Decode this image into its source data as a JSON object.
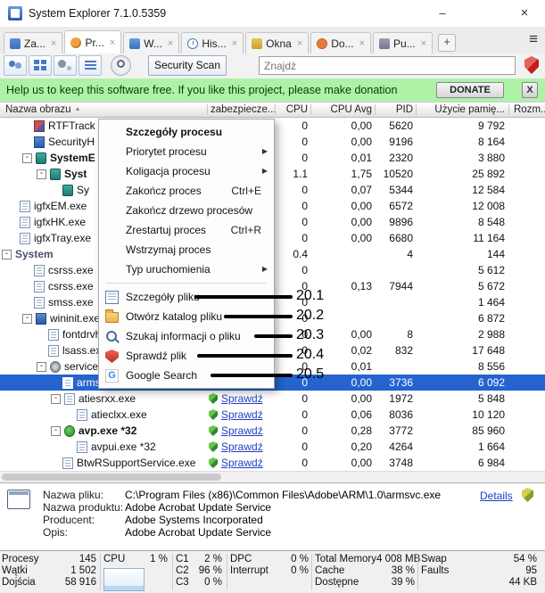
{
  "window": {
    "title": "System Explorer 7.1.0.5359",
    "minimize": "–",
    "close": "×"
  },
  "glyphs": {
    "collapse": "-",
    "sort": "▲",
    "submenu": "▶",
    "tab_close": "×",
    "google_letter": "G"
  },
  "colors": {
    "selection": "#2563cf",
    "donation_bg": "#aef2a8",
    "link": "#1f3fc0",
    "annotation": "#000000"
  },
  "tabs": {
    "items": [
      {
        "label": "Za...",
        "icon": "tasks"
      },
      {
        "label": "Pr...",
        "icon": "process",
        "active": true
      },
      {
        "label": "W...",
        "icon": "performance"
      },
      {
        "label": "His...",
        "icon": "history"
      },
      {
        "label": "Okna",
        "icon": "windows"
      },
      {
        "label": "Do...",
        "icon": "addons"
      },
      {
        "label": "Pu...",
        "icon": "autorun"
      }
    ],
    "add_label": "+",
    "menu_glyph": "≡"
  },
  "toolbar": {
    "security_scan_label": "Security Scan",
    "search_placeholder": "Znajdź"
  },
  "donation": {
    "message": "Help us to keep this software free.  If you like this project, please make donation",
    "donate_label": "DONATE",
    "close_label": "X"
  },
  "columns": {
    "name": "Nazwa obrazu",
    "security": "zabezpiecze...",
    "cpu": "CPU",
    "cpu_avg": "CPU Avg",
    "pid": "PID",
    "memory": "Użycie pamię...",
    "size": "Rozm..."
  },
  "processes": [
    {
      "name": "RTFTrack",
      "level": 2,
      "box": false,
      "icon": "app-red",
      "security": "",
      "cpu": "0",
      "cpu_avg": "0,00",
      "pid": "5620",
      "memory": "9 792"
    },
    {
      "name": "SecurityH",
      "level": 2,
      "box": false,
      "icon": "app-blue",
      "security": "",
      "cpu": "0",
      "cpu_avg": "0,00",
      "pid": "9196",
      "memory": "8 164"
    },
    {
      "name": "SystemE",
      "level": 2,
      "box": true,
      "icon": "app-teal",
      "bold": true,
      "security": "",
      "cpu": "0",
      "cpu_avg": "0,01",
      "pid": "2320",
      "memory": "3 880"
    },
    {
      "name": "Syst",
      "level": 3,
      "box": true,
      "icon": "app-teal",
      "bold": true,
      "security": "",
      "cpu": "1.1",
      "cpu_avg": "1,75",
      "pid": "10520",
      "memory": "25 892"
    },
    {
      "name": "Sy",
      "level": 4,
      "box": false,
      "icon": "app-teal",
      "security": "",
      "cpu": "0",
      "cpu_avg": "0,07",
      "pid": "5344",
      "memory": "12 584"
    },
    {
      "name": "igfxEM.exe",
      "level": 1,
      "box": false,
      "icon": "doc",
      "security": "",
      "cpu": "0",
      "cpu_avg": "0,00",
      "pid": "6572",
      "memory": "12 008"
    },
    {
      "name": "igfxHK.exe",
      "level": 1,
      "box": false,
      "icon": "doc",
      "security": "",
      "cpu": "0",
      "cpu_avg": "0,00",
      "pid": "9896",
      "memory": "8 548"
    },
    {
      "name": "igfxTray.exe",
      "level": 1,
      "box": false,
      "icon": "doc",
      "security": "",
      "cpu": "0",
      "cpu_avg": "0,00",
      "pid": "6680",
      "memory": "11 164"
    },
    {
      "name": "System",
      "level": 0,
      "box": true,
      "icon": "",
      "bold": true,
      "dim": true,
      "security": "",
      "cpu": "0.4",
      "cpu_avg": "",
      "pid": "4",
      "memory": "144"
    },
    {
      "name": "csrss.exe",
      "level": 2,
      "box": false,
      "icon": "doc",
      "security": "",
      "cpu": "0",
      "cpu_avg": "",
      "pid": "",
      "memory": "5 612"
    },
    {
      "name": "csrss.exe",
      "level": 2,
      "box": false,
      "icon": "doc",
      "security": "",
      "cpu": "0",
      "cpu_avg": "0,13",
      "pid": "7944",
      "memory": "5 672"
    },
    {
      "name": "smss.exe",
      "level": 2,
      "box": false,
      "icon": "doc",
      "security": "",
      "cpu": "0",
      "cpu_avg": "",
      "pid": "",
      "memory": "1 464"
    },
    {
      "name": "wininit.exe",
      "level": 2,
      "box": true,
      "icon": "app-blue",
      "security": "",
      "cpu": "0",
      "cpu_avg": "",
      "pid": "",
      "memory": "6 872"
    },
    {
      "name": "fontdrvhost.exe",
      "level": 3,
      "box": false,
      "icon": "doc",
      "security": "",
      "cpu": "0",
      "cpu_avg": "0,00",
      "pid": "8",
      "memory": "2 988"
    },
    {
      "name": "lsass.exe",
      "level": 3,
      "box": false,
      "icon": "doc",
      "security": "",
      "cpu": "0",
      "cpu_avg": "0,02",
      "pid": "832",
      "memory": "17 648"
    },
    {
      "name": "services.exe",
      "level": 3,
      "box": true,
      "icon": "gear",
      "security": "",
      "cpu": "0",
      "cpu_avg": "0,01",
      "pid": "",
      "memory": "8 556"
    },
    {
      "name": "armsvc.exe",
      "level": 4,
      "box": false,
      "icon": "doc",
      "selected": true,
      "security": "",
      "cpu": "0",
      "cpu_avg": "0,00",
      "pid": "3736",
      "memory": "6 092"
    },
    {
      "name": "atiesrxx.exe",
      "level": 4,
      "box": true,
      "icon": "doc",
      "security": "Sprawdź",
      "cpu": "0",
      "cpu_avg": "0,00",
      "pid": "1972",
      "memory": "5 848"
    },
    {
      "name": "atieclxx.exe",
      "level": 5,
      "box": false,
      "icon": "doc",
      "security": "Sprawdź",
      "cpu": "0",
      "cpu_avg": "0,06",
      "pid": "8036",
      "memory": "10 120"
    },
    {
      "name": "avp.exe *32",
      "level": 4,
      "box": true,
      "icon": "app-green",
      "bold": true,
      "security": "Sprawdź",
      "cpu": "0",
      "cpu_avg": "0,28",
      "pid": "3772",
      "memory": "85 960"
    },
    {
      "name": "avpui.exe *32",
      "level": 5,
      "box": false,
      "icon": "doc",
      "security": "Sprawdź",
      "cpu": "0",
      "cpu_avg": "0,20",
      "pid": "4264",
      "memory": "1 664"
    },
    {
      "name": "BtwRSupportService.exe",
      "level": 4,
      "box": false,
      "icon": "doc",
      "security": "Sprawdź",
      "cpu": "0",
      "cpu_avg": "0,00",
      "pid": "3748",
      "memory": "6 984"
    }
  ],
  "context_menu": {
    "items": [
      {
        "label": "Szczegóły procesu",
        "bold": true
      },
      {
        "label": "Priorytet procesu",
        "submenu": true
      },
      {
        "label": "Koligacja procesu",
        "submenu": true
      },
      {
        "label": "Zakończ proces",
        "shortcut": "Ctrl+E"
      },
      {
        "label": "Zakończ drzewo procesów"
      },
      {
        "label": "Zrestartuj proces",
        "shortcut": "Ctrl+R"
      },
      {
        "label": "Wstrzymaj proces"
      },
      {
        "label": "Typ uruchomienia",
        "submenu": true
      },
      {
        "separator": true
      },
      {
        "label": "Szczegóły pliku",
        "icon": "file-details"
      },
      {
        "label": "Otwórz katalog pliku",
        "icon": "folder"
      },
      {
        "label": "Szukaj informacji o pliku",
        "icon": "search-info"
      },
      {
        "label": "Sprawdź plik",
        "icon": "shield-check"
      },
      {
        "label": "Google Search",
        "icon": "google"
      }
    ]
  },
  "annotations": [
    {
      "label": "20.1"
    },
    {
      "label": "20.2"
    },
    {
      "label": "20.3"
    },
    {
      "label": "20.4"
    },
    {
      "label": "20.5"
    }
  ],
  "details": {
    "fields": [
      {
        "label": "Nazwa pliku:",
        "value": "C:\\Program Files (x86)\\Common Files\\Adobe\\ARM\\1.0\\armsvc.exe"
      },
      {
        "label": "Nazwa produktu:",
        "value": "Adobe Acrobat Update Service"
      },
      {
        "label": "Producent:",
        "value": "Adobe Systems Incorporated"
      },
      {
        "label": "Opis:",
        "value": "Adobe Acrobat Update Service"
      }
    ],
    "details_link": "Details"
  },
  "statusbar": {
    "groups": [
      {
        "rows": [
          [
            "Procesy",
            "145"
          ],
          [
            "Wątki",
            "1 502"
          ],
          [
            "Dojścia",
            "58 916"
          ]
        ]
      },
      {
        "rows": [
          [
            "CPU",
            "1 %"
          ]
        ],
        "graph": true
      },
      {
        "rows": [
          [
            "C1",
            "2 %"
          ],
          [
            "C2",
            "96 %"
          ],
          [
            "C3",
            "0 %"
          ]
        ]
      },
      {
        "rows": [
          [
            "DPC",
            "0 %"
          ],
          [
            "Interrupt",
            "0 %"
          ]
        ]
      },
      {
        "rows": [
          [
            "Total Memory",
            "4 008 MB"
          ],
          [
            "Cache",
            "38 %"
          ],
          [
            "Dostępne",
            "39 %"
          ]
        ]
      },
      {
        "rows": [
          [
            "Swap",
            "54 %"
          ],
          [
            "Faults",
            "95"
          ],
          [
            "",
            "44 KB"
          ]
        ]
      }
    ]
  }
}
